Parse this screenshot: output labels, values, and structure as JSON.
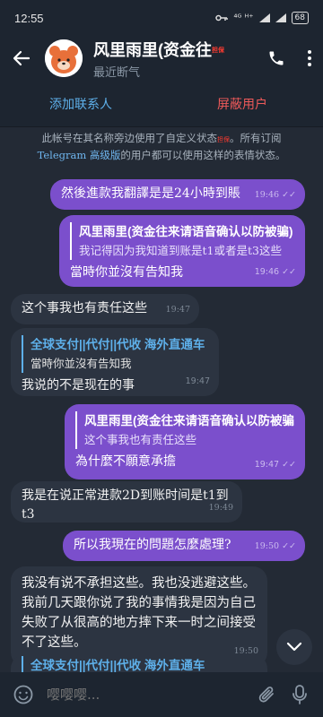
{
  "status": {
    "time": "12:55",
    "network": "⁴ᴳ ᴴ⁺",
    "battery": "68"
  },
  "header": {
    "title": "风里雨里(资金往",
    "title_badge": "担保",
    "subtitle": "最近断气"
  },
  "actions": {
    "add_contact": "添加联系人",
    "block_user": "屏蔽用户"
  },
  "notice": {
    "line1": "此帐号在其名称旁边使用了自定义状态",
    "badge": "担保",
    "line1b": "。所有订阅",
    "link": "Telegram 高级版",
    "line2": "的用户都可以使用这样的表情状态。"
  },
  "messages": [
    {
      "text": "然後進款我翻譯是是24小時到賬",
      "time": "19:46"
    },
    {
      "reply_name": "风里雨里(资金往来请语音确认以防被骗)",
      "reply_text": "我记得因为我知道到账是t1或者是t3这些",
      "text": "當時你並沒有告知我",
      "time": "19:46"
    },
    {
      "text": "这个事我也有责任这些",
      "time": "19:47"
    },
    {
      "reply_name": "全球支付||代付||代收 海外直通车",
      "reply_text": "當時你並沒有告知我",
      "text": "我说的不是现在的事",
      "time": "19:47"
    },
    {
      "reply_name": "风里雨里(资金往来请语音确认以防被骗)",
      "reply_text": "这个事我也有责任这些",
      "text": "為什麼不願意承擔",
      "time": "19:47"
    },
    {
      "text": "我是在说正常进款2D到账时间是t1到t3",
      "time": "19:49"
    },
    {
      "text": "所以我現在的問題怎麼處理?",
      "time": "19:50"
    },
    {
      "text": "我没有说不承担这些。我也没逃避这些。我前几天跟你说了我的事情我是因为自己失败了从很高的地方摔下来一时之间接受不了这些。",
      "time": "19:50"
    },
    {
      "reply_name": "全球支付||代付||代收 海外直通车"
    }
  ],
  "input": {
    "placeholder": "嘤嘤嘤..."
  }
}
